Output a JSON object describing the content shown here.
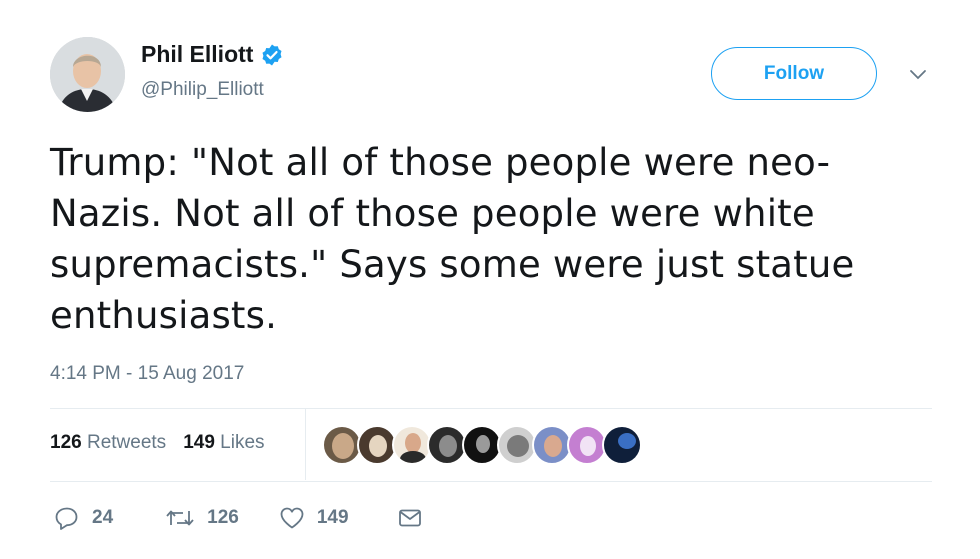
{
  "author": {
    "display_name": "Phil Elliott",
    "handle": "@Philip_Elliott",
    "verified": true
  },
  "follow_button": {
    "label": "Follow"
  },
  "tweet": {
    "text": "Trump: \"Not all of those people were neo-Nazis. Not all of those people were white supremacists.\" Says some were just statue enthusiasts.",
    "timestamp": "4:14 PM - 15 Aug 2017"
  },
  "stats": {
    "retweets_count": "126",
    "retweets_label": "Retweets",
    "likes_count": "149",
    "likes_label": "Likes"
  },
  "likers": [
    {
      "icon": "liker-avatar-1"
    },
    {
      "icon": "liker-avatar-2"
    },
    {
      "icon": "liker-avatar-3"
    },
    {
      "icon": "liker-avatar-4"
    },
    {
      "icon": "liker-avatar-5"
    },
    {
      "icon": "liker-avatar-6"
    },
    {
      "icon": "liker-avatar-7"
    },
    {
      "icon": "liker-avatar-8"
    },
    {
      "icon": "liker-avatar-9"
    }
  ],
  "actions": {
    "reply_count": "24",
    "retweet_count": "126",
    "like_count": "149",
    "icons": [
      "reply-icon",
      "retweet-icon",
      "like-icon",
      "direct-message-icon"
    ]
  },
  "colors": {
    "accent": "#1da1f2",
    "text": "#14171a",
    "secondary": "#657786",
    "border": "#e6ecf0"
  }
}
